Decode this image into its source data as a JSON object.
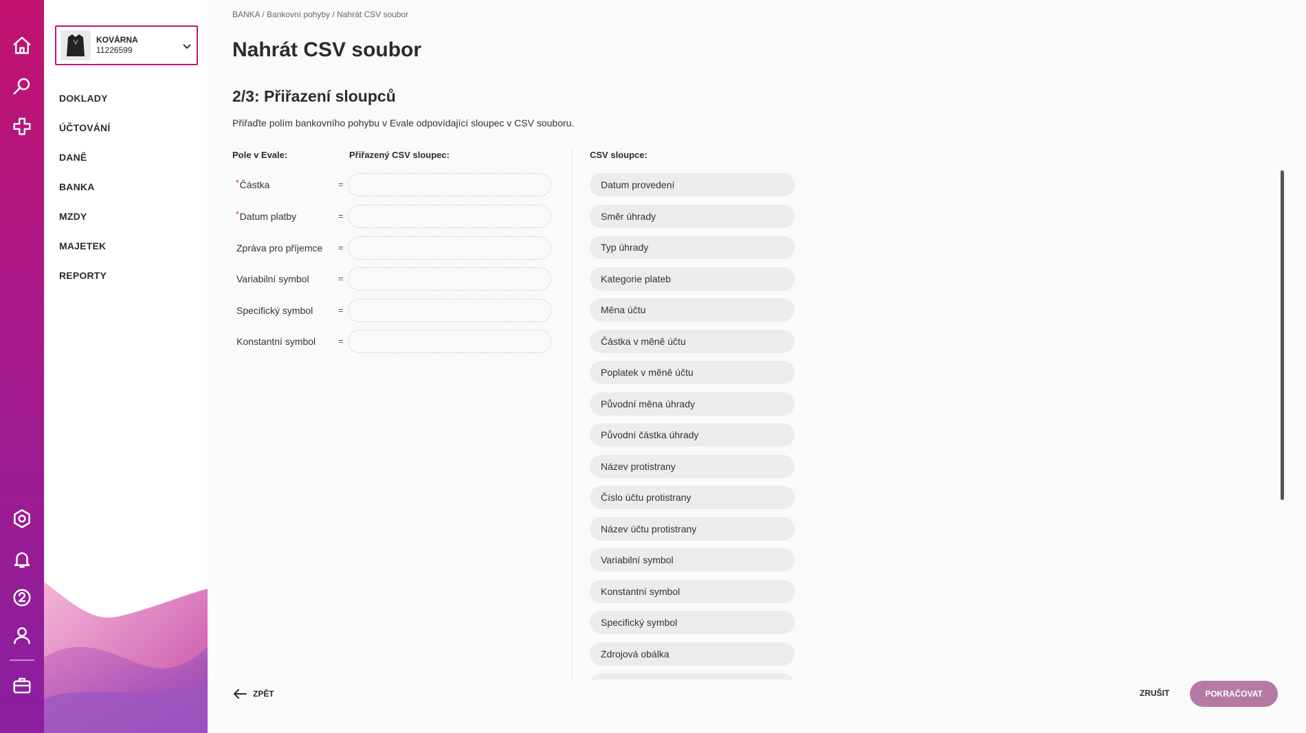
{
  "company": {
    "name": "KOVÁRNA",
    "id": "11226599"
  },
  "nav": [
    "DOKLADY",
    "ÚČTOVÁNÍ",
    "DANĚ",
    "BANKA",
    "MZDY",
    "MAJETEK",
    "REPORTY"
  ],
  "breadcrumb": "BANKA / Bankovní pohyby / Nahrát CSV soubor",
  "title": "Nahrát CSV soubor",
  "subtitle": "2/3: Přiřazení sloupců",
  "description": "Přiřaďte polím bankovního pohybu v Evale odpovídající sloupec v CSV souboru.",
  "headers": {
    "fields": "Pole v Evale:",
    "assigned": "Přiřazený CSV sloupec:",
    "csv": "CSV sloupce:"
  },
  "fields": [
    {
      "label": "Částka",
      "required": "*"
    },
    {
      "label": "Datum platby",
      "required": "*"
    },
    {
      "label": "Zpráva pro příjemce",
      "required": ""
    },
    {
      "label": "Variabilní symbol",
      "required": ""
    },
    {
      "label": "Specifický symbol",
      "required": ""
    },
    {
      "label": "Konstantní symbol",
      "required": ""
    }
  ],
  "equals": "=",
  "csv_columns": [
    "Datum provedení",
    "Směr úhrady",
    "Typ úhrady",
    "Kategorie plateb",
    "Měna účtu",
    "Částka v měně účtu",
    "Poplatek v měně účtu",
    "Původní měna úhrady",
    "Původní částka úhrady",
    "Název protistrany",
    "Číslo účtu protistrany",
    "Název účtu protistrany",
    "Variabilní symbol",
    "Konstantní symbol",
    "Specifický symbol",
    "Zdrojová obálka",
    ""
  ],
  "footer": {
    "back": "ZPĚT",
    "cancel": "ZRUŠIT",
    "continue": "POKRAČOVAT"
  },
  "colors": {
    "accent": "#c2126f",
    "continue_button": "#b57aa4"
  }
}
